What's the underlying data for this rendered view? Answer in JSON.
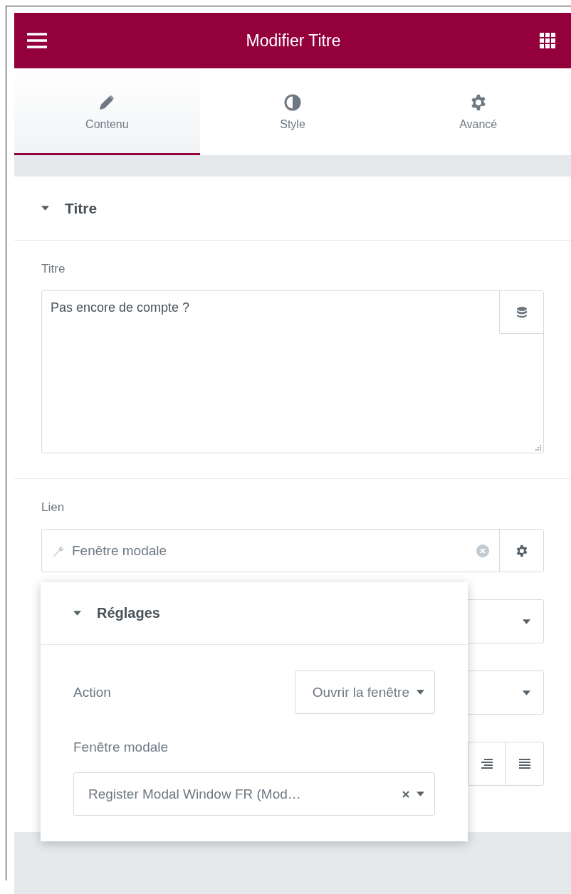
{
  "header": {
    "title": "Modifier Titre"
  },
  "tabs": [
    {
      "label": "Contenu",
      "selected": true
    },
    {
      "label": "Style",
      "selected": false
    },
    {
      "label": "Avancé",
      "selected": false
    }
  ],
  "section": {
    "title": "Titre",
    "expanded": true
  },
  "title_field": {
    "label": "Titre",
    "value": "Pas encore de compte ?"
  },
  "link_field": {
    "label": "Lien",
    "value": "Fenêtre modale"
  },
  "popup": {
    "title": "Réglages",
    "expanded": true,
    "action": {
      "label": "Action",
      "value": "Ouvrir la fenêtre"
    },
    "modal": {
      "label": "Fenêtre modale",
      "value": "Register Modal Window FR (Mod…"
    }
  }
}
